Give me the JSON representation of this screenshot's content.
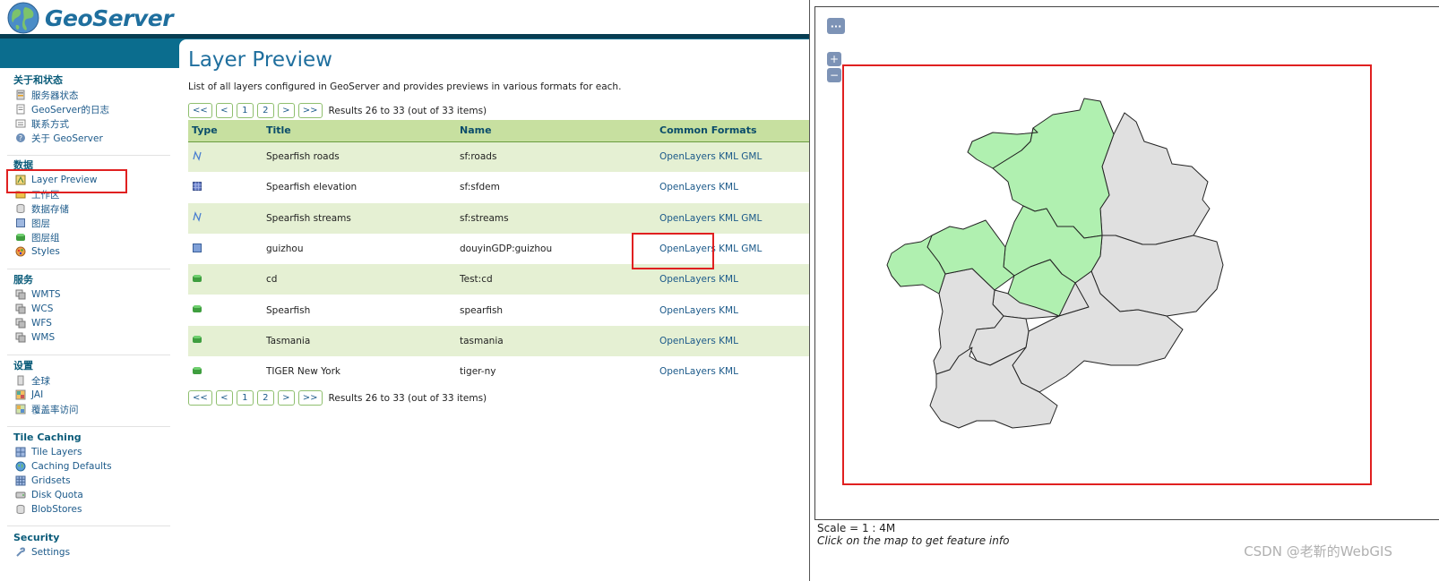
{
  "app": {
    "logo_text": "GeoServer"
  },
  "sidebar": {
    "sections": [
      {
        "heading": "关于和状态",
        "items": [
          {
            "label": "服务器状态",
            "icon": "server-status-icon"
          },
          {
            "label": "GeoServer的日志",
            "icon": "log-icon"
          },
          {
            "label": "联系方式",
            "icon": "contact-icon"
          },
          {
            "label": "关于 GeoServer",
            "icon": "about-icon"
          }
        ]
      },
      {
        "heading": "数据",
        "items": [
          {
            "label": "Layer Preview",
            "icon": "layer-preview-icon"
          },
          {
            "label": "工作区",
            "icon": "workspace-icon"
          },
          {
            "label": "数据存储",
            "icon": "datastore-icon"
          },
          {
            "label": "图层",
            "icon": "layers-icon"
          },
          {
            "label": "图层组",
            "icon": "layergroup-icon"
          },
          {
            "label": "Styles",
            "icon": "styles-icon"
          }
        ]
      },
      {
        "heading": "服务",
        "items": [
          {
            "label": "WMTS",
            "icon": "service-icon"
          },
          {
            "label": "WCS",
            "icon": "service-icon"
          },
          {
            "label": "WFS",
            "icon": "service-icon"
          },
          {
            "label": "WMS",
            "icon": "service-icon"
          }
        ]
      },
      {
        "heading": "设置",
        "items": [
          {
            "label": "全球",
            "icon": "global-icon"
          },
          {
            "label": "JAI",
            "icon": "jai-icon"
          },
          {
            "label": "覆盖率访问",
            "icon": "coverage-icon"
          }
        ]
      },
      {
        "heading": "Tile Caching",
        "items": [
          {
            "label": "Tile Layers",
            "icon": "tile-icon"
          },
          {
            "label": "Caching Defaults",
            "icon": "globe-icon"
          },
          {
            "label": "Gridsets",
            "icon": "grid-icon"
          },
          {
            "label": "Disk Quota",
            "icon": "disk-icon"
          },
          {
            "label": "BlobStores",
            "icon": "blob-icon"
          }
        ]
      },
      {
        "heading": "Security",
        "items": [
          {
            "label": "Settings",
            "icon": "settings-icon"
          }
        ]
      }
    ]
  },
  "main": {
    "title": "Layer Preview",
    "description": "List of all layers configured in GeoServer and provides previews in various formats for each.",
    "pager": {
      "first": "<<",
      "prev": "<",
      "page1": "1",
      "page2": "2",
      "next": ">",
      "last": ">>",
      "info": "Results 26 to 33 (out of 33 items)"
    },
    "table": {
      "headers": {
        "type": "Type",
        "title": "Title",
        "name": "Name",
        "formats": "Common Formats"
      },
      "rows": [
        {
          "type": "line",
          "title": "Spearfish roads",
          "name": "sf:roads",
          "formats": [
            "OpenLayers",
            "KML",
            "GML"
          ]
        },
        {
          "type": "raster",
          "title": "Spearfish elevation",
          "name": "sf:sfdem",
          "formats": [
            "OpenLayers",
            "KML"
          ]
        },
        {
          "type": "line",
          "title": "Spearfish streams",
          "name": "sf:streams",
          "formats": [
            "OpenLayers",
            "KML",
            "GML"
          ]
        },
        {
          "type": "polygon",
          "title": "guizhou",
          "name": "douyinGDP:guizhou",
          "formats": [
            "OpenLayers",
            "KML",
            "GML"
          ]
        },
        {
          "type": "group",
          "title": "cd",
          "name": "Test:cd",
          "formats": [
            "OpenLayers",
            "KML"
          ]
        },
        {
          "type": "group",
          "title": "Spearfish",
          "name": "spearfish",
          "formats": [
            "OpenLayers",
            "KML"
          ]
        },
        {
          "type": "group",
          "title": "Tasmania",
          "name": "tasmania",
          "formats": [
            "OpenLayers",
            "KML"
          ]
        },
        {
          "type": "group",
          "title": "TIGER New York",
          "name": "tiger-ny",
          "formats": [
            "OpenLayers",
            "KML"
          ]
        }
      ]
    }
  },
  "preview": {
    "layer_switcher": "···",
    "zoom_in": "+",
    "zoom_out": "−",
    "scale": "Scale = 1 : 4M",
    "hint": "Click on the map to get feature info",
    "fill_highlight": "#b0f0b0",
    "fill_default": "#e0e0e0"
  },
  "watermark": "CSDN @老靳的WebGIS"
}
